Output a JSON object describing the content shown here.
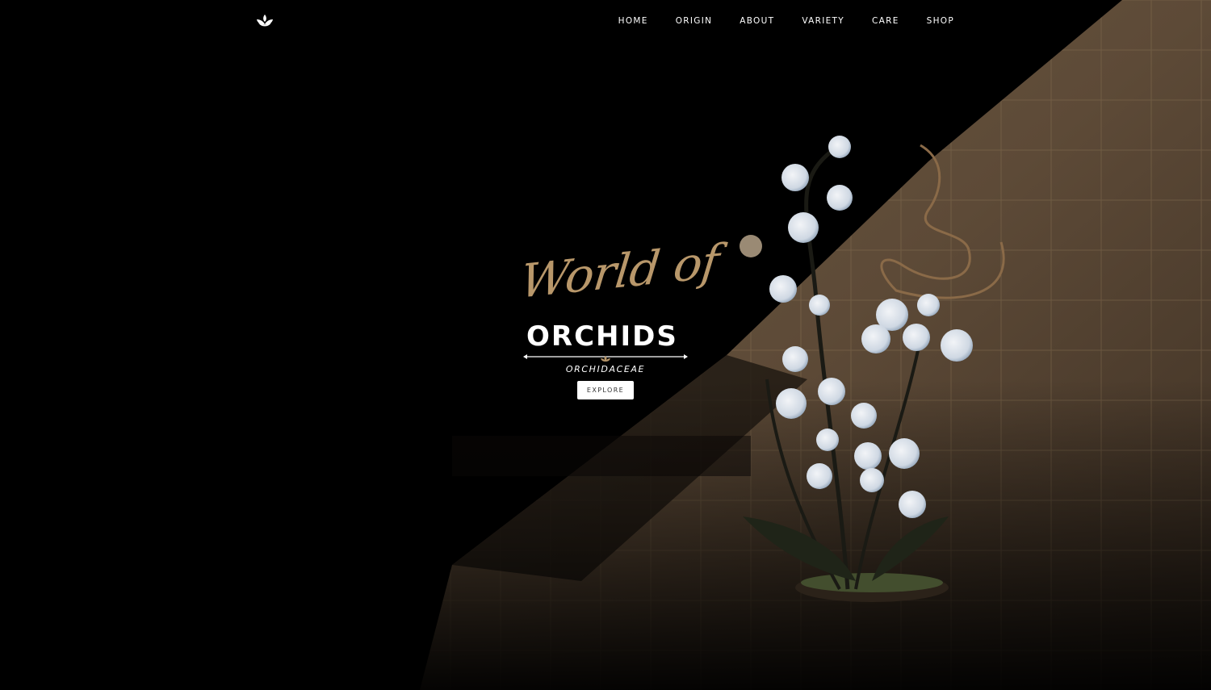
{
  "nav": {
    "logo_icon": "lotus-icon",
    "items": [
      {
        "label": "HOME"
      },
      {
        "label": "ORIGIN"
      },
      {
        "label": "ABOUT"
      },
      {
        "label": "VARIETY"
      },
      {
        "label": "CARE"
      },
      {
        "label": "SHOP"
      }
    ]
  },
  "hero": {
    "script_title": "World of",
    "main_title": "ORCHIDS",
    "subtitle": "ORCHIDACEAE",
    "button_label": "EXPLORE"
  },
  "colors": {
    "accent_gold": "#b8976a",
    "background": "#000000",
    "text": "#ffffff"
  }
}
